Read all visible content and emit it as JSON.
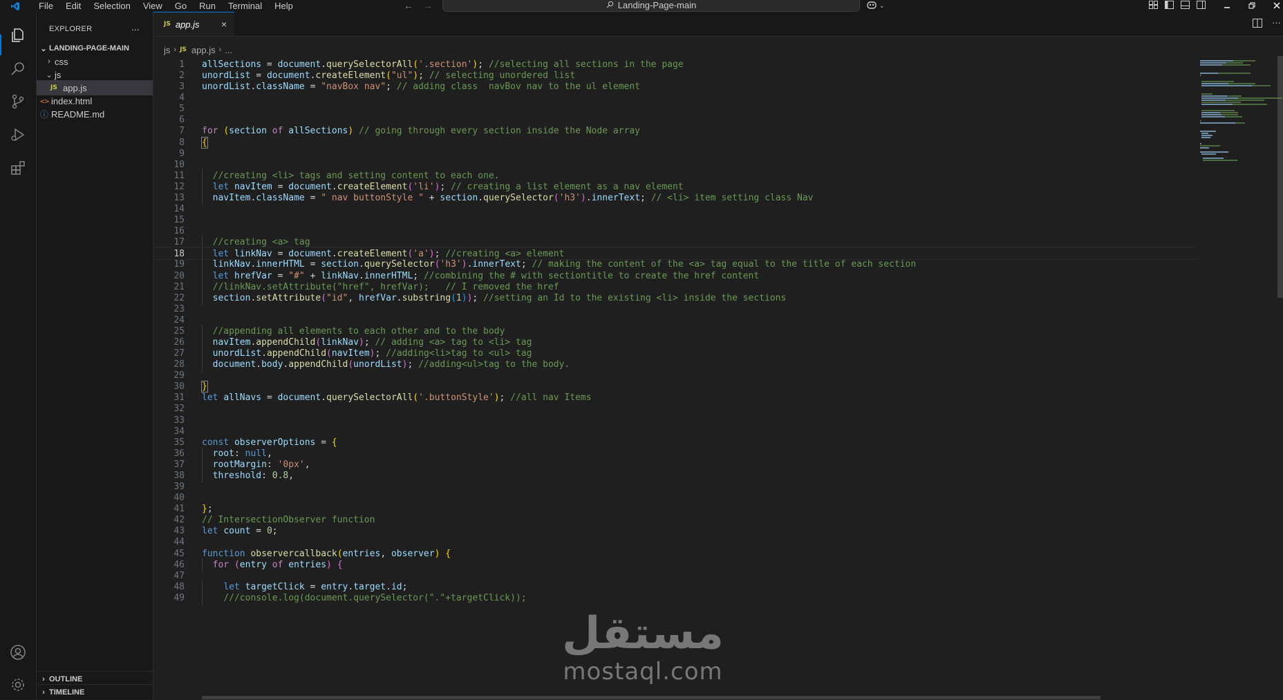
{
  "titlebar": {
    "menu": [
      "File",
      "Edit",
      "Selection",
      "View",
      "Go",
      "Run",
      "Terminal",
      "Help"
    ],
    "search_text": "Landing-Page-main",
    "icons": [
      "vscode-logo-icon",
      "arrow-left-icon",
      "arrow-right-icon",
      "search-icon",
      "copilot-icon",
      "customize-layout-icon",
      "toggle-sidebar-icon",
      "toggle-panel-icon",
      "toggle-secondary-sidebar-icon",
      "minimize-icon",
      "restore-icon",
      "close-icon"
    ]
  },
  "activitybar": {
    "items": [
      "explorer-icon",
      "search-icon",
      "source-control-icon",
      "run-debug-icon",
      "extensions-icon"
    ],
    "bottom": [
      "accounts-icon",
      "manage-gear-icon"
    ]
  },
  "sidebar": {
    "header": "EXPLORER",
    "more": "...",
    "root": "LANDING-PAGE-MAIN",
    "items": [
      {
        "label": "css",
        "type": "folder",
        "expanded": false
      },
      {
        "label": "js",
        "type": "folder",
        "expanded": true
      },
      {
        "label": "app.js",
        "type": "js",
        "selected": true
      },
      {
        "label": "index.html",
        "type": "html"
      },
      {
        "label": "README.md",
        "type": "info"
      }
    ],
    "sections": [
      "OUTLINE",
      "TIMELINE"
    ]
  },
  "editor": {
    "tab": {
      "badge": "JS",
      "label": "app.js",
      "close": "×"
    },
    "breadcrumb": [
      "js",
      "app.js",
      "..."
    ],
    "current_line": 18,
    "lines": [
      "allSections = document.querySelectorAll('.section'); //selecting all sections in the page",
      "unordList = document.createElement(\"ul\"); // selecting unordered list",
      "unordList.className = \"navBox nav\"; // adding class  navBov nav to the ul element",
      "",
      "",
      "",
      "for (section of allSections) // going through every section inside the Node array",
      "{",
      "",
      "",
      "  //creating <li> tags and setting content to each one.",
      "  let navItem = document.createElement('li'); // creating a list element as a nav element",
      "  navItem.className = \" nav buttonStyle \" + section.querySelector('h3').innerText; // <li> item setting class Nav",
      "",
      "",
      "",
      "  //creating <a> tag",
      "  let linkNav = document.createElement('a'); //creating <a> element",
      "  linkNav.innerHTML = section.querySelector('h3').innerText; // making the content of the <a> tag equal to the title of each section",
      "  let hrefVar = \"#\" + linkNav.innerHTML; //combining the # with sectiontitle to create the href content",
      "  //linkNav.setAttribute(\"href\", hrefVar);   // I removed the href",
      "  section.setAttribute(\"id\", hrefVar.substring(1)); //setting an Id to the existing <li> inside the sections",
      "",
      "",
      "  //appending all elements to each other and to the body",
      "  navItem.appendChild(linkNav); // adding <a> tag to <li> tag",
      "  unordList.appendChild(navItem); //adding<li>tag to <ul> tag",
      "  document.body.appendChild(unordList); //adding<ul>tag to the body.",
      "",
      "}",
      "let allNavs = document.querySelectorAll('.buttonStyle'); //all nav Items",
      "",
      "",
      "",
      "const observerOptions = {",
      "  root: null,",
      "  rootMargin: '0px',",
      "  threshold: 0.8,",
      "",
      "",
      "};",
      "// IntersectionObserver function",
      "let count = 0;",
      "",
      "function observercallback(entries, observer) {",
      "  for (entry of entries) {",
      "",
      "    let targetClick = entry.target.id;",
      "    ///console.log(document.querySelector(\".\"+targetClick));"
    ]
  },
  "watermark": {
    "arabic": "مستقل",
    "latin": "mostaql.com"
  },
  "colors": {
    "accent": "#0078d4",
    "background": "#1f1f1f",
    "sidebar": "#181818",
    "comment": "#6a9955",
    "string": "#ce9178",
    "keyword": "#569cd6",
    "variable": "#9cdcfe",
    "function": "#dcdcaa"
  }
}
